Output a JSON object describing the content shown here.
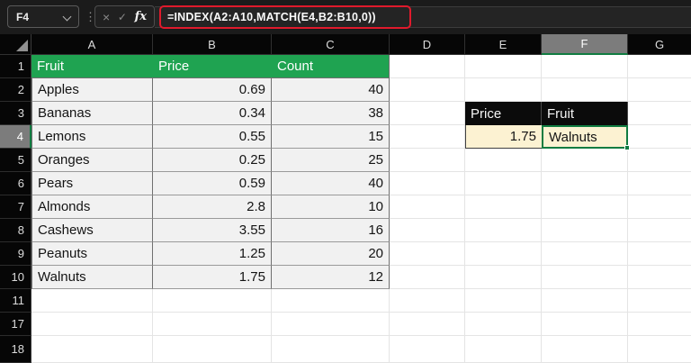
{
  "formula_bar": {
    "name_box_value": "F4",
    "kebab_icon": "⋮",
    "cancel_icon": "×",
    "enter_icon": "✓",
    "fx_label": "fx",
    "formula": "=INDEX(A2:A10,MATCH(E4,B2:B10,0))"
  },
  "colors": {
    "annotation_red": "#e01a2c",
    "selection_green": "#107c41",
    "table_header_green": "#1fa351",
    "highlight_fill": "#fcf2d2",
    "header_dark": "#060606",
    "selected_header_gray": "#7c7c7c"
  },
  "sheet": {
    "columns": [
      "A",
      "B",
      "C",
      "D",
      "E",
      "F",
      "G"
    ],
    "rows": [
      "1",
      "2",
      "3",
      "4",
      "5",
      "6",
      "7",
      "8",
      "9",
      "10",
      "11",
      "17",
      "18"
    ],
    "active_cell": "F4",
    "selected_column": "F",
    "selected_row": "4",
    "fruit_table": {
      "columns": [
        "A",
        "B",
        "C"
      ],
      "header_row": "1",
      "headers": [
        "Fruit",
        "Price",
        "Count"
      ],
      "align": [
        "left",
        "right",
        "right"
      ],
      "data_rows": [
        "2",
        "3",
        "4",
        "5",
        "6",
        "7",
        "8",
        "9",
        "10"
      ],
      "rows": [
        [
          "Apples",
          "0.69",
          "40"
        ],
        [
          "Bananas",
          "0.34",
          "38"
        ],
        [
          "Lemons",
          "0.55",
          "15"
        ],
        [
          "Oranges",
          "0.25",
          "25"
        ],
        [
          "Pears",
          "0.59",
          "40"
        ],
        [
          "Almonds",
          "2.8",
          "10"
        ],
        [
          "Cashews",
          "3.55",
          "16"
        ],
        [
          "Peanuts",
          "1.25",
          "20"
        ],
        [
          "Walnuts",
          "1.75",
          "12"
        ]
      ]
    },
    "lookup_table": {
      "columns": [
        "E",
        "F"
      ],
      "header_row": "3",
      "headers": [
        "Price",
        "Fruit"
      ],
      "value_row": "4",
      "values": [
        "1.75",
        "Walnuts"
      ],
      "align": [
        "right",
        "left"
      ]
    }
  }
}
